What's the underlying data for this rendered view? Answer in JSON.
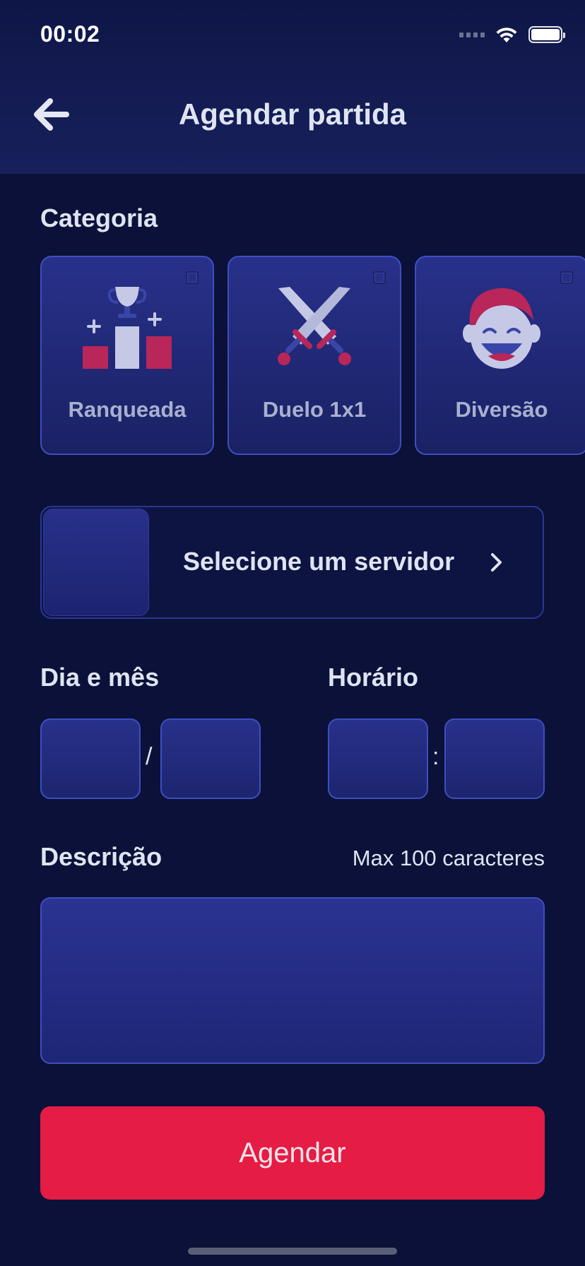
{
  "status_bar": {
    "time": "00:02"
  },
  "header": {
    "title": "Agendar partida",
    "back_icon": "arrow-left-icon"
  },
  "category": {
    "title": "Categoria",
    "items": [
      {
        "label": "Ranqueada",
        "icon": "trophy-podium-icon",
        "checked": false
      },
      {
        "label": "Duelo 1x1",
        "icon": "crossed-swords-icon",
        "checked": false
      },
      {
        "label": "Diversão",
        "icon": "laughing-face-icon",
        "checked": false
      }
    ]
  },
  "server": {
    "label": "Selecione um servidor",
    "icon": "chevron-right-icon"
  },
  "date": {
    "title": "Dia e mês",
    "day": "",
    "month": "",
    "separator": "/"
  },
  "time": {
    "title": "Horário",
    "hour": "",
    "minute": "",
    "separator": ":"
  },
  "description": {
    "title": "Descrição",
    "limit_text": "Max 100 caracteres",
    "value": ""
  },
  "submit": {
    "label": "Agendar"
  },
  "colors": {
    "background": "#0b1138",
    "card": "#28318a",
    "card_border": "#3d4fbf",
    "accent": "#e51c44",
    "icon_secondary": "#c5c9e6"
  }
}
